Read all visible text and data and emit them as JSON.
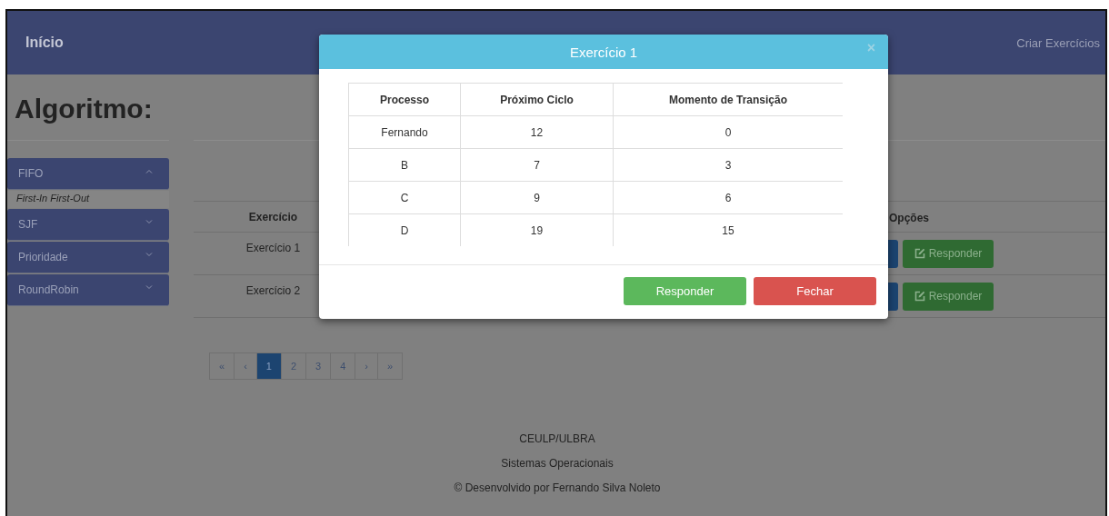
{
  "navbar": {
    "brand": "Início",
    "link": "Criar Exercícios"
  },
  "heading": "Algoritmo:",
  "sidebar": {
    "items": [
      {
        "label": "FIFO",
        "expanded": true,
        "description": "First-In First-Out"
      },
      {
        "label": "SJF",
        "expanded": false
      },
      {
        "label": "Prioridade",
        "expanded": false
      },
      {
        "label": "RoundRobin",
        "expanded": false
      }
    ]
  },
  "table": {
    "columns": [
      "Exercício",
      "Opções"
    ],
    "rows": [
      {
        "name": "Exercício 1",
        "action": "Responder"
      },
      {
        "name": "Exercício 2",
        "action": "Responder"
      }
    ]
  },
  "pagination": [
    {
      "label": "«",
      "selected": false
    },
    {
      "label": "‹",
      "selected": false
    },
    {
      "label": "1",
      "selected": true
    },
    {
      "label": "2",
      "selected": false
    },
    {
      "label": "3",
      "selected": false
    },
    {
      "label": "4",
      "selected": false
    },
    {
      "label": "›",
      "selected": false
    },
    {
      "label": "»",
      "selected": false
    }
  ],
  "footer": [
    "CEULP/ULBRA",
    "Sistemas Operacionais",
    "© Desenvolvido por Fernando Silva Noleto"
  ],
  "modal": {
    "title": "Exercício 1",
    "close": "×",
    "columns": [
      "Processo",
      "Próximo Ciclo",
      "Momento de Transição"
    ],
    "rows": [
      [
        "Fernando",
        "12",
        "0"
      ],
      [
        "B",
        "7",
        "3"
      ],
      [
        "C",
        "9",
        "6"
      ],
      [
        "D",
        "19",
        "15"
      ]
    ],
    "buttons": [
      {
        "kind": "primary",
        "label": "Responder"
      },
      {
        "kind": "danger",
        "label": "Fechar"
      }
    ]
  }
}
